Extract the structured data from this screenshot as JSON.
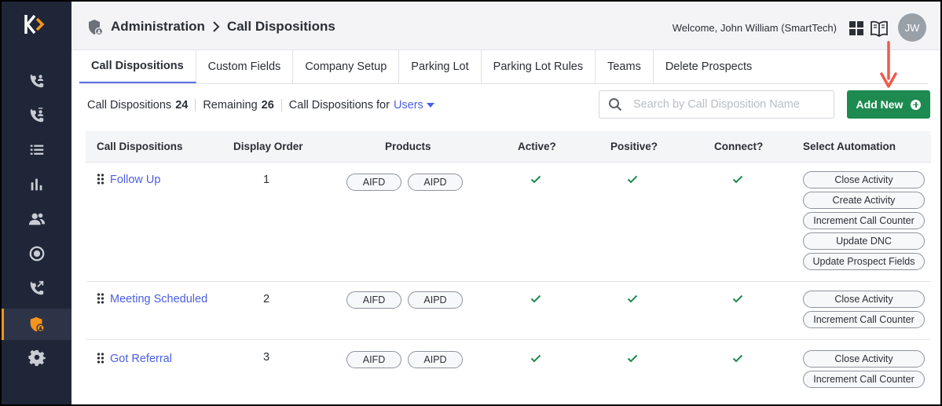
{
  "header": {
    "breadcrumb": [
      "Administration",
      "Call Dispositions"
    ],
    "welcome_prefix": "Welcome, John William",
    "welcome_org": "(SmartTech)",
    "avatar_initials": "JW"
  },
  "tabs": [
    {
      "label": "Call Dispositions",
      "active": true
    },
    {
      "label": "Custom Fields"
    },
    {
      "label": "Company Setup"
    },
    {
      "label": "Parking Lot"
    },
    {
      "label": "Parking Lot Rules"
    },
    {
      "label": "Teams"
    },
    {
      "label": "Delete Prospects"
    }
  ],
  "toolbar": {
    "count_label": "Call Dispositions",
    "count_value": "24",
    "remaining_label": "Remaining",
    "remaining_value": "26",
    "for_label": "Call Dispositions for",
    "for_value": "Users",
    "search_placeholder": "Search by Call Disposition Name",
    "add_label": "Add New"
  },
  "table": {
    "columns": [
      "Call Dispositions",
      "Display Order",
      "Products",
      "Active?",
      "Positive?",
      "Connect?",
      "Select Automation"
    ],
    "rows": [
      {
        "name": "Follow Up",
        "order": "1",
        "products": [
          "AIFD",
          "AIPD"
        ],
        "automations": [
          "Close Activity",
          "Create Activity",
          "Increment Call Counter",
          "Update DNC",
          "Update Prospect Fields"
        ]
      },
      {
        "name": "Meeting Scheduled",
        "order": "2",
        "products": [
          "AIFD",
          "AIPD"
        ],
        "automations": [
          "Close Activity",
          "Increment Call Counter"
        ]
      },
      {
        "name": "Got Referral",
        "order": "3",
        "products": [
          "AIFD",
          "AIPD"
        ],
        "automations": [
          "Close Activity",
          "Increment Call Counter"
        ]
      }
    ]
  },
  "colors": {
    "sidebar": "#1f2637",
    "accent": "#f7941d",
    "link": "#4a5ee0",
    "primary_button": "#1d8a4f",
    "check": "#1d8a4f",
    "annotation_arrow": "#f0594a"
  },
  "icons": {
    "sidebar": [
      "incoming-calls-icon",
      "outgoing-calls-icon",
      "list-icon",
      "bar-chart-icon",
      "users-icon",
      "record-icon",
      "call-transfer-icon",
      "admin-shield-icon",
      "settings-gear-icon"
    ]
  }
}
